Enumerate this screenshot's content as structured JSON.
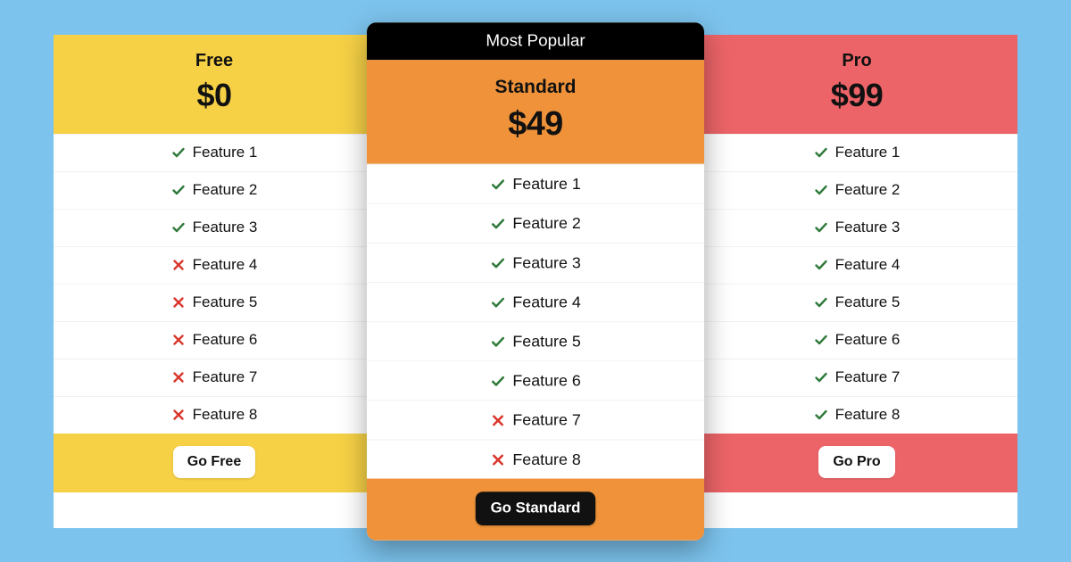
{
  "badge": "Most Popular",
  "features": [
    "Feature 1",
    "Feature 2",
    "Feature 3",
    "Feature 4",
    "Feature 5",
    "Feature 6",
    "Feature 7",
    "Feature 8"
  ],
  "plans": [
    {
      "key": "free",
      "name": "Free",
      "price": "$0",
      "cta": "Go Free",
      "cta_style": "light",
      "highlight": false,
      "included": [
        true,
        true,
        true,
        false,
        false,
        false,
        false,
        false
      ]
    },
    {
      "key": "standard",
      "name": "Standard",
      "price": "$49",
      "cta": "Go Standard",
      "cta_style": "dark",
      "highlight": true,
      "included": [
        true,
        true,
        true,
        true,
        true,
        true,
        false,
        false
      ]
    },
    {
      "key": "pro",
      "name": "Pro",
      "price": "$99",
      "cta": "Go Pro",
      "cta_style": "light",
      "highlight": false,
      "included": [
        true,
        true,
        true,
        true,
        true,
        true,
        true,
        true
      ]
    }
  ],
  "icons": {
    "check_color": "#2f7a3a",
    "cross_color": "#d9372d"
  }
}
